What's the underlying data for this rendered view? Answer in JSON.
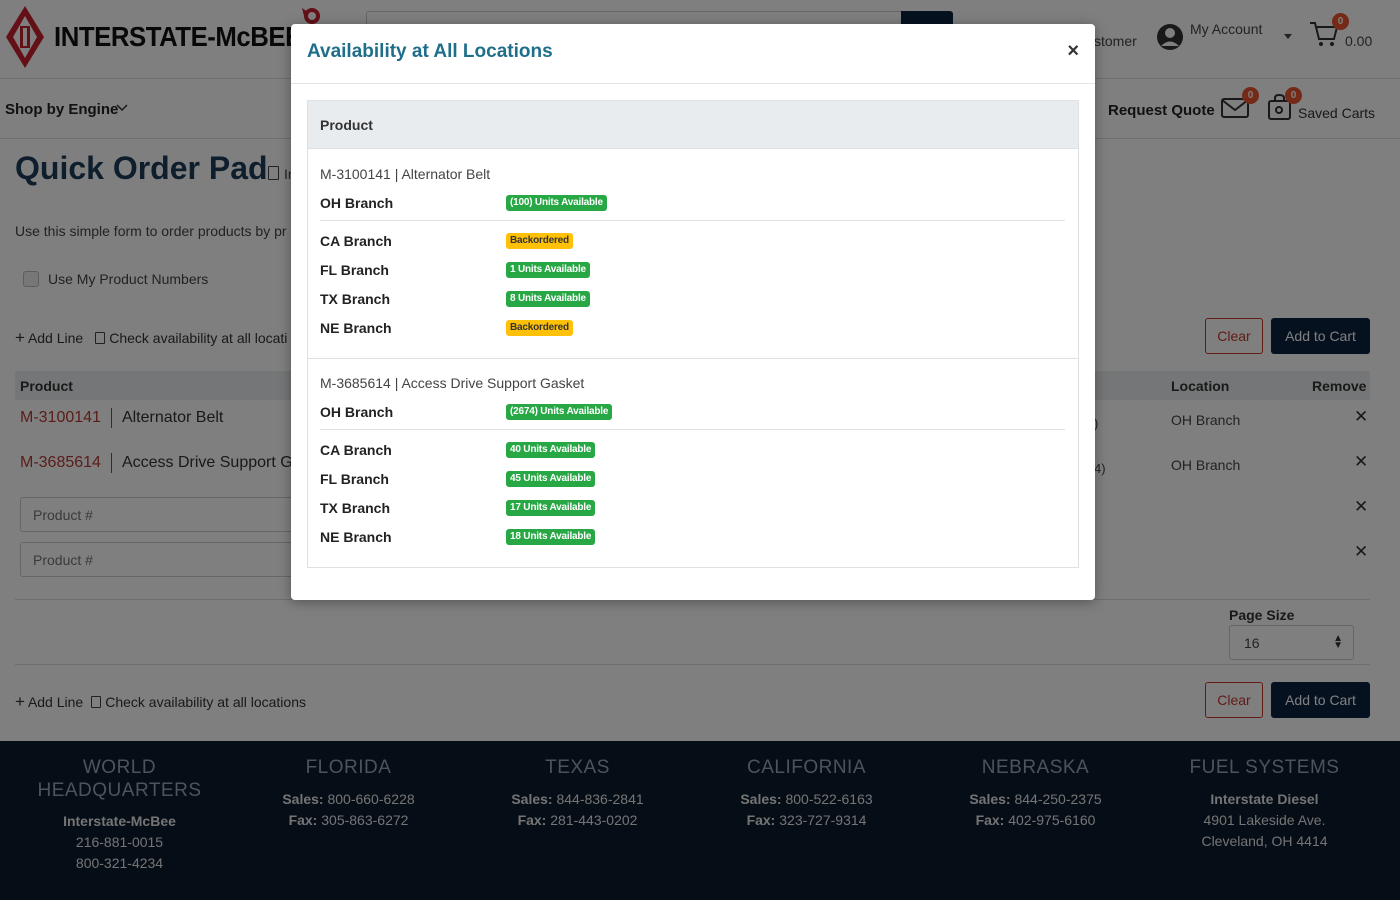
{
  "header": {
    "logo_text": "INTERSTATE-McBEE",
    "customer_label": "stomer",
    "account_label": "My Account",
    "cart_total": "0.00",
    "cart_count": "0"
  },
  "nav": {
    "shop_by_engine": "Shop by Engine",
    "request_quote": "Request Quote",
    "mail_count": "0",
    "saved_count": "0",
    "saved_carts": "Saved Carts"
  },
  "page": {
    "title": "Quick Order Pad",
    "title_frag": "Ir",
    "intro": "Use this simple form to order products by pr",
    "use_my_numbers": "Use My Product Numbers",
    "add_line": "Add Line",
    "check_avail_short": "Check availability at all locati",
    "check_avail": "Check availability at all locations",
    "clear_label": "Clear",
    "add_to_cart_label": "Add to Cart",
    "columns": {
      "product": "Product",
      "location": "Location",
      "remove": "Remove"
    },
    "rows": [
      {
        "code": "M-3100141",
        "desc": "Alternator Belt",
        "qty_frag": ")",
        "location": "OH Branch"
      },
      {
        "code": "M-3685614",
        "desc": "Access Drive Support G",
        "qty_frag": "4)",
        "location": "OH Branch"
      }
    ],
    "input_placeholder": "Product #",
    "page_size_label": "Page Size",
    "page_size_value": "16"
  },
  "footer": [
    {
      "title": "WORLD HEADQUARTERS",
      "lines": [
        {
          "bold": "Interstate-McBee",
          "text": ""
        },
        {
          "bold": "",
          "text": "216-881-0015"
        },
        {
          "bold": "",
          "text": "800-321-4234"
        }
      ]
    },
    {
      "title": "FLORIDA",
      "lines": [
        {
          "bold": "Sales:",
          "text": " 800-660-6228"
        },
        {
          "bold": "Fax:",
          "text": " 305-863-6272"
        }
      ]
    },
    {
      "title": "TEXAS",
      "lines": [
        {
          "bold": "Sales:",
          "text": " 844-836-2841"
        },
        {
          "bold": "Fax:",
          "text": " 281-443-0202"
        }
      ]
    },
    {
      "title": "CALIFORNIA",
      "lines": [
        {
          "bold": "Sales:",
          "text": " 800-522-6163"
        },
        {
          "bold": "Fax:",
          "text": " 323-727-9314"
        }
      ]
    },
    {
      "title": "NEBRASKA",
      "lines": [
        {
          "bold": "Sales:",
          "text": " 844-250-2375"
        },
        {
          "bold": "Fax:",
          "text": " 402-975-6160"
        }
      ]
    },
    {
      "title": "FUEL SYSTEMS",
      "lines": [
        {
          "bold": "Interstate Diesel",
          "text": ""
        },
        {
          "bold": "",
          "text": "4901 Lakeside Ave."
        },
        {
          "bold": "",
          "text": "Cleveland, OH 4414"
        }
      ]
    }
  ],
  "modal": {
    "title": "Availability at All Locations",
    "close": "×",
    "column": "Product",
    "products": [
      {
        "title": "M-3100141 | Alternator Belt",
        "primary": {
          "branch": "OH Branch",
          "status": "(100) Units Available",
          "type": "available"
        },
        "others": [
          {
            "branch": "CA Branch",
            "status": "Backordered",
            "type": "backordered"
          },
          {
            "branch": "FL Branch",
            "status": "1 Units Available",
            "type": "available"
          },
          {
            "branch": "TX Branch",
            "status": "8 Units Available",
            "type": "available"
          },
          {
            "branch": "NE Branch",
            "status": "Backordered",
            "type": "backordered"
          }
        ]
      },
      {
        "title": "M-3685614 | Access Drive Support Gasket",
        "primary": {
          "branch": "OH Branch",
          "status": "(2674) Units Available",
          "type": "available"
        },
        "others": [
          {
            "branch": "CA Branch",
            "status": "40 Units Available",
            "type": "available"
          },
          {
            "branch": "FL Branch",
            "status": "45 Units Available",
            "type": "available"
          },
          {
            "branch": "TX Branch",
            "status": "17 Units Available",
            "type": "available"
          },
          {
            "branch": "NE Branch",
            "status": "18 Units Available",
            "type": "available"
          }
        ]
      }
    ]
  },
  "colors": {
    "navy": "#0d2240",
    "brand_red": "#c0392b",
    "available_green": "#28a745",
    "backordered_yellow": "#ffc107",
    "modal_title": "#1f6f8b"
  }
}
